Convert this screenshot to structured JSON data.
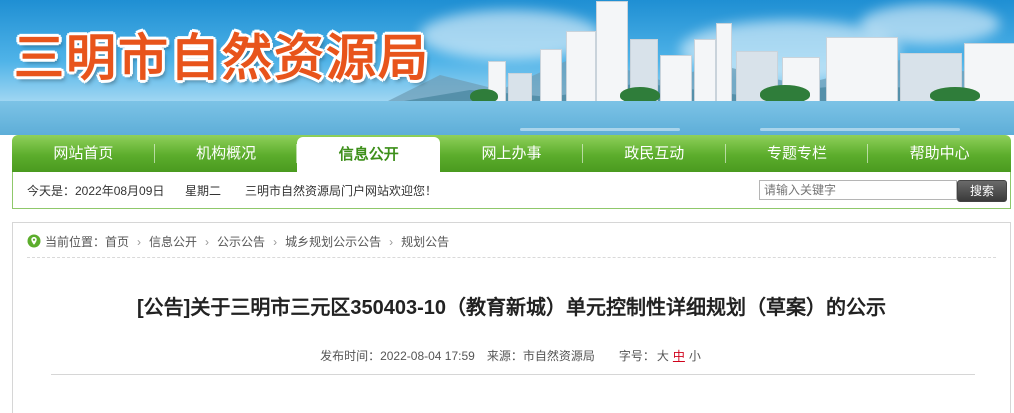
{
  "site": {
    "title": "三明市自然资源局",
    "brand_color": "#e8541b"
  },
  "nav": {
    "items": [
      {
        "label": "网站首页"
      },
      {
        "label": "机构概况"
      },
      {
        "label": "信息公开",
        "active": true
      },
      {
        "label": "网上办事"
      },
      {
        "label": "政民互动"
      },
      {
        "label": "专题专栏"
      },
      {
        "label": "帮助中心"
      }
    ],
    "color": "#5cad2c"
  },
  "infobar": {
    "date": "今天是：2022年08月09日",
    "weekday": "星期二",
    "welcome": "三明市自然资源局门户网站欢迎您！",
    "search_placeholder": "请输入关键字",
    "search_button": "搜索"
  },
  "breadcrumb": {
    "prefix": "当前位置：",
    "items": [
      "首页",
      "信息公开",
      "公示公告",
      "城乡规划公示公告",
      "规划公告"
    ],
    "home_icon": "location-pin-icon"
  },
  "article": {
    "title": "[公告]关于三明市三元区350403-10（教育新城）单元控制性详细规划（草案）的公示",
    "published_label": "发布时间：",
    "published_value": "2022-08-04 17:59",
    "source_label": "来源：",
    "source_value": "市自然资源局",
    "fontsize_label": "字号：",
    "fontsize_large": "大",
    "fontsize_medium": "中",
    "fontsize_small": "小"
  }
}
